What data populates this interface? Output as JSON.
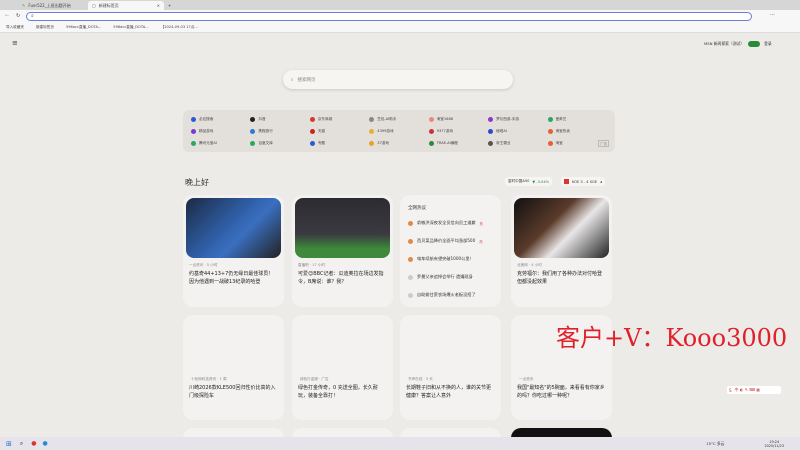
{
  "tabs": [
    {
      "label": "Fuer522_上班出题开始"
    },
    {
      "label": "新建标签页"
    }
  ],
  "bookmarks": [
    "导入收藏夹",
    "新建标签页",
    "596acc直播_DOTA...",
    "596acc直播_DOTA...",
    "【2024-09-03 17点..."
  ],
  "header": {
    "msn_label": "MSN 新闻探索（测试）",
    "login": "登录"
  },
  "search": {
    "placeholder": "搜索网页"
  },
  "quick_links": [
    "必应搜索",
    "抖音",
    "京东商城",
    "豆包-AI助手",
    "淘宝1688",
    "梦幻西游-手游",
    "爱奇艺",
    "精品游戏",
    "携程旅行",
    "天猫",
    "4399游戏",
    "9377游戏",
    "秘塔AI",
    "淘宝热卖",
    "腾讯元宝AI",
    "百度文库",
    "专题",
    "37游戏",
    "TRAE-AI编程",
    "帝王霸业",
    "淘宝"
  ],
  "quick_ad": "广告",
  "greeting": "晚上好",
  "ticker": {
    "name": "富时中国A50",
    "change": "-3.04%",
    "match": "KOE 3 - 4 SGE"
  },
  "cards_row1": [
    {
      "meta": "一点资讯 · 5 小时",
      "title": "约基奇44+13+7仍无缘日最佳球员！因为他遇到一战破13纪录的哈登"
    },
    {
      "meta": "直播吧 · 17 小时",
      "title": "可爱😊BBC记者：瓜迪奥拉在场边发指令，B席说：谁？我？"
    },
    {
      "meta": "北美网 · 4 小时",
      "title": "克劳福尔：我们用了各种办法对付哈登 但都没起效果"
    }
  ],
  "hot": {
    "title": "全网热议",
    "items": [
      "俞敏洪深夜发全员信向员工道歉",
      "西贝菜品降价全面平均涨部500",
      "电车续航有望突破1000公里！",
      "罗曼父亲追悼会举行 遗孀现身",
      "自助偷甘蔗农场爆火老板没招了"
    ],
    "badge": "热"
  },
  "cards_row2": [
    {
      "meta": "十轮网科技资讯 · 1 周",
      "title": "川崎2026款KLE500回归性价比高的入门级探险车"
    },
    {
      "meta": "绿色打金服 · 广告",
      "title": "绿色打金传奇，0 充送全图，长久耐玩，装备全靠打！"
    },
    {
      "meta": "节声在线 · 3 天",
      "title": "长期鞋子旧和从不换的人，谁的关节更健康？答案让人意外"
    },
    {
      "meta": "一点资讯",
      "title": "我国\"最知名\"的5碗面，来看看有你家乡的吗？你吃过哪一种呢？"
    }
  ],
  "watermark": "客户+V：Kooo3000",
  "tray": {
    "weather": "15°C 多云",
    "time": "19:24",
    "date": "2025/11/23"
  }
}
